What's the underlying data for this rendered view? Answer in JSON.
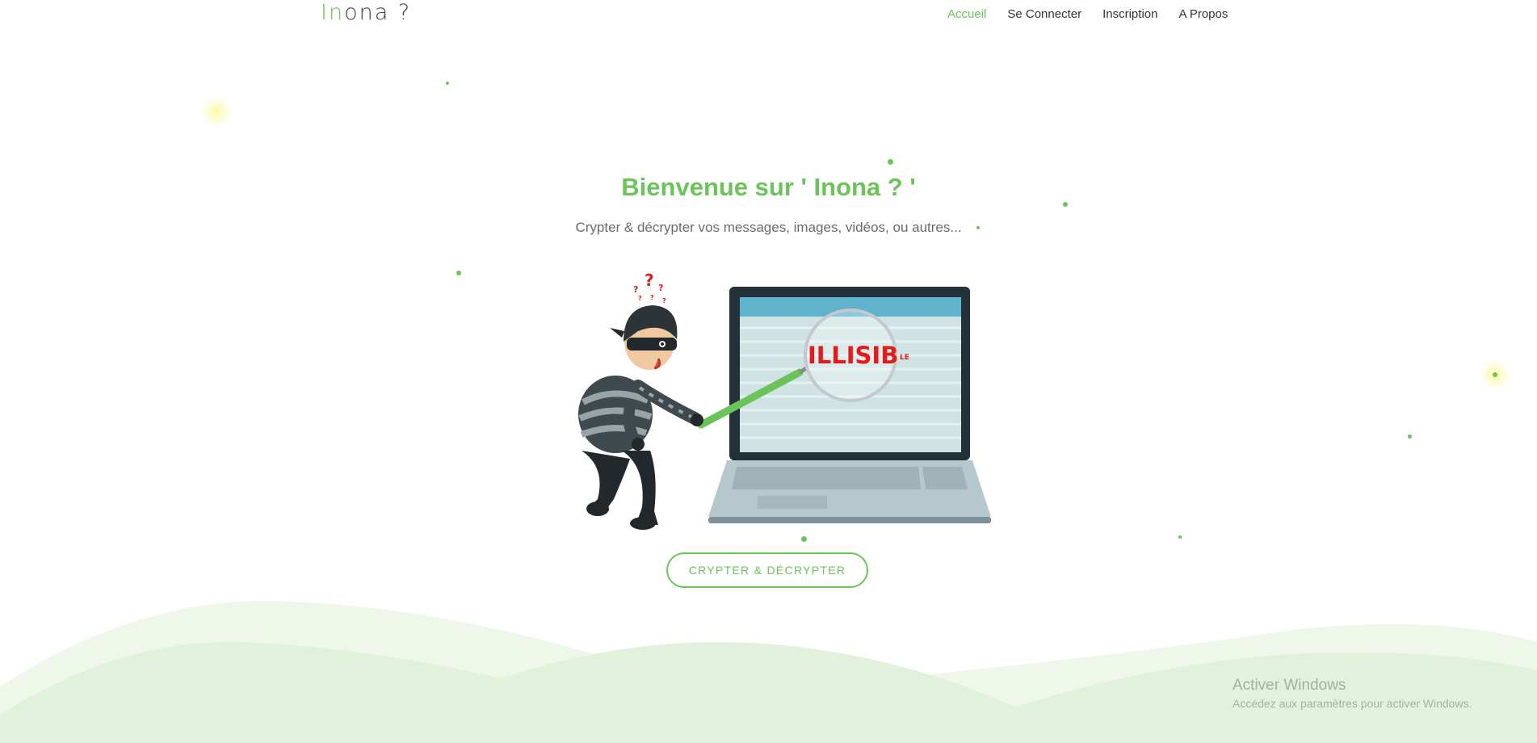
{
  "brand": {
    "first": "In",
    "rest": "ona ?"
  },
  "nav": {
    "items": [
      {
        "label": "Accueil",
        "active": true
      },
      {
        "label": "Se Connecter",
        "active": false
      },
      {
        "label": "Inscription",
        "active": false
      },
      {
        "label": "A Propos",
        "active": false
      }
    ]
  },
  "hero": {
    "title": "Bienvenue sur ' Inona ? '",
    "subtitle": "Crypter & décrypter vos messages, images, vidéos, ou autres...",
    "cta_label": "CRYPTER & DÉCRYPTER"
  },
  "illustration": {
    "magnified_text": "ILLISIB",
    "trailing_text": "LE",
    "question_marks": [
      "?",
      "?",
      "?",
      "?",
      "?",
      "?"
    ]
  },
  "watermark": {
    "title": "Activer Windows",
    "subtitle": "Accédez aux paramètres pour activer Windows."
  },
  "colors": {
    "accent": "#6bc45a",
    "illustration_red": "#e31b1b",
    "wave_light": "#eef7ea",
    "wave_dark": "#e2f1dc"
  }
}
